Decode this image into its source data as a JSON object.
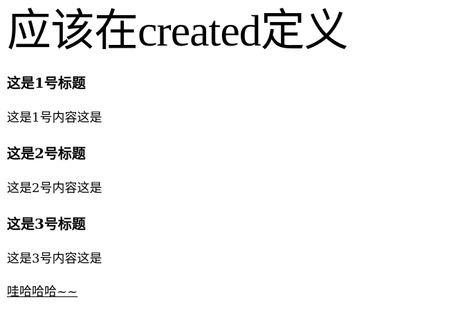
{
  "heading": {
    "title_prefix": "应该在",
    "title_latin": "created",
    "title_suffix": "定义"
  },
  "sections": [
    {
      "title": "这是1号标题",
      "content": "这是1号内容这是"
    },
    {
      "title": "这是2号标题",
      "content": "这是2号内容这是"
    },
    {
      "title": "这是3号标题",
      "content": "这是3号内容这是"
    }
  ],
  "footer_link": "哇哈哈哈~~"
}
